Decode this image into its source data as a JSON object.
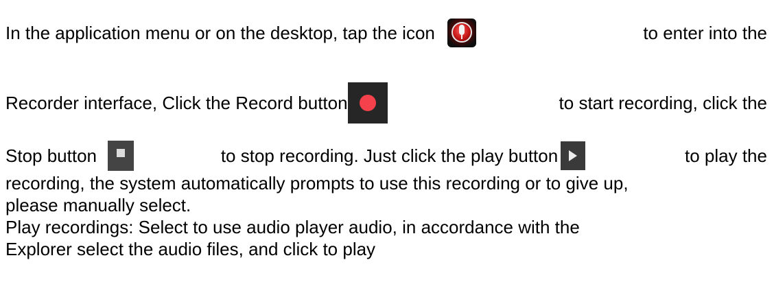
{
  "line1": {
    "before_icon": "In the application menu or on the desktop, tap the icon",
    "after_icon": "to enter into the"
  },
  "line2": {
    "before_icon": "Recorder interface, Click the Record button",
    "after_icon": "to start recording, click the"
  },
  "line3": {
    "before_icon": "Stop button",
    "middle": "to stop recording. Just click the play button",
    "after_icon": "to play the"
  },
  "line4": "recording, the system automatically prompts to use this recording or to give up,",
  "line5": "please manually select.",
  "line6": "Play recordings: Select to use audio player audio, in accordance with the",
  "line7": "Explorer select the audio files, and click to play",
  "icons": {
    "app": "recorder-app-icon",
    "record": "record-button-icon",
    "stop": "stop-button-icon",
    "play": "play-button-icon"
  },
  "colors": {
    "record_dot": "#f4414b",
    "icon_background": "#262626"
  }
}
